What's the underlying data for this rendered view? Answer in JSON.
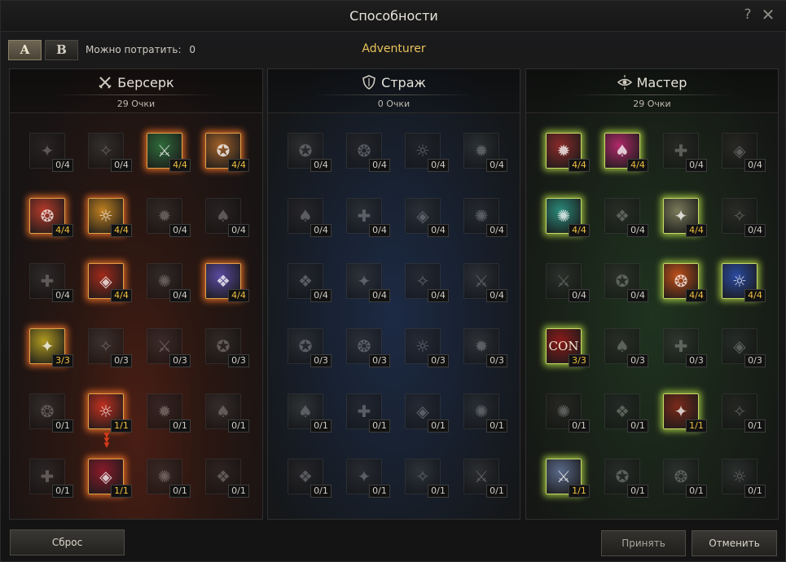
{
  "window": {
    "title": "Способности"
  },
  "toolbar": {
    "presets": [
      "A",
      "B"
    ],
    "spend_label": "Можно потратить:",
    "spend_value": "0",
    "class_name": "Adventurer"
  },
  "panels": [
    {
      "name": "Берсерк",
      "points": "29 Очки",
      "icon": "crossed-swords-icon",
      "skills": [
        {
          "level": "0/4",
          "state": "locked",
          "color": "#7a3a3a",
          "icon": "hand-icon"
        },
        {
          "level": "0/4",
          "state": "locked",
          "color": "#4a6a5a",
          "icon": "axe-icon"
        },
        {
          "level": "4/4",
          "state": "active",
          "color": "#2f6b3a",
          "icon": "hammer-icon"
        },
        {
          "level": "4/4",
          "state": "active",
          "color": "#a0602a",
          "icon": "fist-icon"
        },
        {
          "level": "4/4",
          "state": "active",
          "color": "#b53a2a",
          "icon": "rage-face-icon"
        },
        {
          "level": "4/4",
          "state": "active",
          "color": "#c08020",
          "icon": "totem-icon"
        },
        {
          "level": "0/4",
          "state": "locked",
          "color": "#3a5a4a",
          "icon": "sword-icon"
        },
        {
          "level": "0/4",
          "state": "locked",
          "color": "#5a3a5a",
          "icon": "claw-icon"
        },
        {
          "level": "0/4",
          "state": "locked",
          "color": "#3a5a6a",
          "icon": "blade-icon"
        },
        {
          "level": "4/4",
          "state": "active",
          "color": "#a02a1a",
          "icon": "demon-eye-icon"
        },
        {
          "level": "0/4",
          "state": "locked",
          "color": "#2a5a6a",
          "icon": "slash-icon"
        },
        {
          "level": "4/4",
          "state": "active",
          "color": "#5a4aa0",
          "icon": "spiral-icon"
        },
        {
          "level": "3/3",
          "state": "active",
          "color": "#b09a20",
          "icon": "dual-blades-icon"
        },
        {
          "level": "0/3",
          "state": "locked",
          "color": "#3a6a6a",
          "icon": "shard-icon"
        },
        {
          "level": "0/3",
          "state": "locked",
          "color": "#6a4a6a",
          "icon": "tendril-icon"
        },
        {
          "level": "0/3",
          "state": "locked",
          "color": "#4a5a3a",
          "icon": "boot-icon"
        },
        {
          "level": "0/1",
          "state": "locked",
          "color": "#5a5a5a",
          "icon": "gauntlet-icon"
        },
        {
          "level": "1/1",
          "state": "active",
          "color": "#c03020",
          "icon": "burning-hand-icon"
        },
        {
          "level": "0/1",
          "state": "locked",
          "color": "#4a3a6a",
          "icon": "wing-icon"
        },
        {
          "level": "0/1",
          "state": "locked",
          "color": "#5a5a6a",
          "icon": "warrior-icon"
        },
        {
          "level": "0/1",
          "state": "locked",
          "color": "#3a4a6a",
          "icon": "leg-icon"
        },
        {
          "level": "1/1",
          "state": "active",
          "color": "#8a1a2a",
          "icon": "skull-icon"
        },
        {
          "level": "0/1",
          "state": "locked",
          "color": "#4a4a5a",
          "icon": "helmet-icon"
        },
        {
          "level": "0/1",
          "state": "locked",
          "color": "#6a3a3a",
          "icon": "blood-icon"
        }
      ]
    },
    {
      "name": "Страж",
      "points": "0 Очки",
      "icon": "shield-icon",
      "skills": [
        {
          "level": "0/4",
          "state": "locked",
          "color": "#6a5a3a",
          "icon": "bell-icon"
        },
        {
          "level": "0/4",
          "state": "locked",
          "color": "#5a3a3a",
          "icon": "cross-icon"
        },
        {
          "level": "0/4",
          "state": "locked",
          "color": "#3a3a4a",
          "icon": "spear-icon"
        },
        {
          "level": "0/4",
          "state": "locked",
          "color": "#3a6a6a",
          "icon": "mask-icon"
        },
        {
          "level": "0/4",
          "state": "locked",
          "color": "#6a3a2a",
          "icon": "flame-icon"
        },
        {
          "level": "0/4",
          "state": "locked",
          "color": "#3a5a5a",
          "icon": "wheel-icon"
        },
        {
          "level": "0/4",
          "state": "locked",
          "color": "#3a5a5a",
          "icon": "rune-icon"
        },
        {
          "level": "0/4",
          "state": "locked",
          "color": "#3a4a6a",
          "icon": "arm-icon"
        },
        {
          "level": "0/4",
          "state": "locked",
          "color": "#4a3a6a",
          "icon": "lance-icon"
        },
        {
          "level": "0/4",
          "state": "locked",
          "color": "#5a5a3a",
          "icon": "shield-bash-icon"
        },
        {
          "level": "0/4",
          "state": "locked",
          "color": "#5a3a3a",
          "icon": "orb-icon"
        },
        {
          "level": "0/4",
          "state": "locked",
          "color": "#6a5a4a",
          "icon": "knight-icon"
        },
        {
          "level": "0/3",
          "state": "locked",
          "color": "#4a5a5a",
          "icon": "seal-icon"
        },
        {
          "level": "0/3",
          "state": "locked",
          "color": "#6a4a3a",
          "icon": "talon-icon"
        },
        {
          "level": "0/3",
          "state": "locked",
          "color": "#5a3a4a",
          "icon": "veil-icon"
        },
        {
          "level": "0/3",
          "state": "locked",
          "color": "#6a5a3a",
          "icon": "horn-icon"
        },
        {
          "level": "0/1",
          "state": "locked",
          "color": "#5a6a3a",
          "icon": "vine-icon"
        },
        {
          "level": "0/1",
          "state": "locked",
          "color": "#3a3a6a",
          "icon": "eye-icon"
        },
        {
          "level": "0/1",
          "state": "locked",
          "color": "#5a3a6a",
          "icon": "whip-icon"
        },
        {
          "level": "0/1",
          "state": "locked",
          "color": "#3a5a6a",
          "icon": "swords-icon"
        },
        {
          "level": "0/1",
          "state": "locked",
          "color": "#6a3a3a",
          "icon": "ember-icon"
        },
        {
          "level": "0/1",
          "state": "locked",
          "color": "#5a4a3a",
          "icon": "ring-icon"
        },
        {
          "level": "0/1",
          "state": "locked",
          "color": "#3a6a5a",
          "icon": "spirit-icon"
        },
        {
          "level": "0/1",
          "state": "locked",
          "color": "#5a5a4a",
          "icon": "fortress-icon"
        }
      ]
    },
    {
      "name": "Мастер",
      "points": "29 Очки",
      "icon": "eye-sigil-icon",
      "skills": [
        {
          "level": "4/4",
          "state": "active",
          "color": "#8a2a2a",
          "icon": "armored-knight-icon"
        },
        {
          "level": "4/4",
          "state": "active",
          "color": "#b02a6a",
          "icon": "helm-icon"
        },
        {
          "level": "0/4",
          "state": "locked",
          "color": "#6a3a4a",
          "icon": "claws-icon"
        },
        {
          "level": "0/4",
          "state": "locked",
          "color": "#7a3a3a",
          "icon": "circle-slash-icon"
        },
        {
          "level": "4/4",
          "state": "active",
          "color": "#2a8a7a",
          "icon": "swirl-icon"
        },
        {
          "level": "0/4",
          "state": "locked",
          "color": "#5a4a3a",
          "icon": "dash-icon"
        },
        {
          "level": "4/4",
          "state": "active",
          "color": "#7a7a5a",
          "icon": "brute-icon"
        },
        {
          "level": "0/4",
          "state": "locked",
          "color": "#5a4a3a",
          "icon": "fist-guard-icon"
        },
        {
          "level": "0/4",
          "state": "locked",
          "color": "#4a5a5a",
          "icon": "emblem-icon"
        },
        {
          "level": "0/4",
          "state": "locked",
          "color": "#6a4a3a",
          "icon": "gear-cross-icon"
        },
        {
          "level": "4/4",
          "state": "active",
          "color": "#c0501a",
          "icon": "fire-wave-icon"
        },
        {
          "level": "4/4",
          "state": "active",
          "color": "#2a4aa0",
          "icon": "champion-icon"
        },
        {
          "level": "3/3",
          "state": "active",
          "color": "#8a1a1a",
          "icon": "con-icon",
          "text": "CON"
        },
        {
          "level": "0/3",
          "state": "locked",
          "color": "#6a3a3a",
          "icon": "shadow-icon"
        },
        {
          "level": "0/3",
          "state": "locked",
          "color": "#4a5a5a",
          "icon": "sprint-icon"
        },
        {
          "level": "0/3",
          "state": "locked",
          "color": "#3a4a6a",
          "icon": "arrow-icon"
        },
        {
          "level": "0/1",
          "state": "locked",
          "color": "#6a3a3a",
          "icon": "strike-icon"
        },
        {
          "level": "0/1",
          "state": "locked",
          "color": "#3a3a5a",
          "icon": "rogue-icon"
        },
        {
          "level": "1/1",
          "state": "active",
          "color": "#7a2a1a",
          "icon": "crimson-claw-icon"
        },
        {
          "level": "0/1",
          "state": "locked",
          "color": "#4a3a3a",
          "icon": "cape-icon"
        },
        {
          "level": "1/1",
          "state": "active",
          "color": "#5a6a8a",
          "icon": "ninja-icon"
        },
        {
          "level": "0/1",
          "state": "locked",
          "color": "#4a4a6a",
          "icon": "phantom-icon"
        },
        {
          "level": "0/1",
          "state": "locked",
          "color": "#4a5a7a",
          "icon": "feather-icon"
        },
        {
          "level": "0/1",
          "state": "locked",
          "color": "#4a5a6a",
          "icon": "talisman-icon"
        }
      ]
    }
  ],
  "footer": {
    "reset": "Сброс",
    "accept": "Принять",
    "cancel": "Отменить"
  }
}
